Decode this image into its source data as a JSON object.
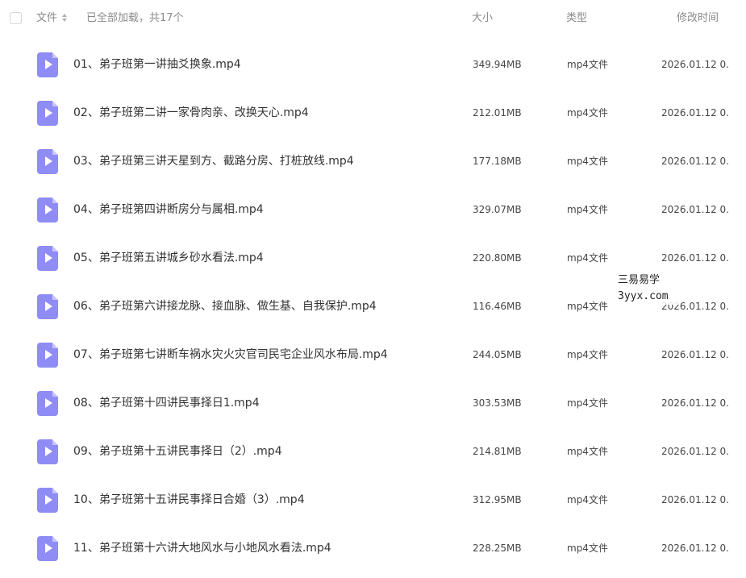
{
  "header": {
    "name_label": "文件",
    "load_status": "已全部加载，共17个",
    "size_label": "大小",
    "type_label": "类型",
    "time_label": "修改时间"
  },
  "files": [
    {
      "name": "01、弟子班第一讲抽爻换象.mp4",
      "size": "349.94MB",
      "type": "mp4文件",
      "time": "2026.01.12 0..."
    },
    {
      "name": "02、弟子班第二讲一家骨肉亲、改换天心.mp4",
      "size": "212.01MB",
      "type": "mp4文件",
      "time": "2026.01.12 0..."
    },
    {
      "name": "03、弟子班第三讲天星到方、截路分房、打桩放线.mp4",
      "size": "177.18MB",
      "type": "mp4文件",
      "time": "2026.01.12 0..."
    },
    {
      "name": "04、弟子班第四讲断房分与属相.mp4",
      "size": "329.07MB",
      "type": "mp4文件",
      "time": "2026.01.12 0..."
    },
    {
      "name": "05、弟子班第五讲城乡砂水看法.mp4",
      "size": "220.80MB",
      "type": "mp4文件",
      "time": "2026.01.12 0..."
    },
    {
      "name": "06、弟子班第六讲接龙脉、接血脉、做生基、自我保护.mp4",
      "size": "116.46MB",
      "type": "mp4文件",
      "time": "2026.01.12 0..."
    },
    {
      "name": "07、弟子班第七讲断车祸水灾火灾官司民宅企业风水布局.mp4",
      "size": "244.05MB",
      "type": "mp4文件",
      "time": "2026.01.12 0..."
    },
    {
      "name": "08、弟子班第十四讲民事择日1.mp4",
      "size": "303.53MB",
      "type": "mp4文件",
      "time": "2026.01.12 0..."
    },
    {
      "name": "09、弟子班第十五讲民事择日（2）.mp4",
      "size": "214.81MB",
      "type": "mp4文件",
      "time": "2026.01.12 0..."
    },
    {
      "name": "10、弟子班第十五讲民事择日合婚（3）.mp4",
      "size": "312.95MB",
      "type": "mp4文件",
      "time": "2026.01.12 0..."
    },
    {
      "name": "11、弟子班第十六讲大地风水与小地风水看法.mp4",
      "size": "228.25MB",
      "type": "mp4文件",
      "time": "2026.01.12 0..."
    }
  ],
  "watermark": {
    "line1": "三易易学",
    "line2": "3yyx.com"
  },
  "colors": {
    "video_icon": "#8f8cf5",
    "header_text": "#8a8a8a",
    "body_text": "#333333"
  }
}
